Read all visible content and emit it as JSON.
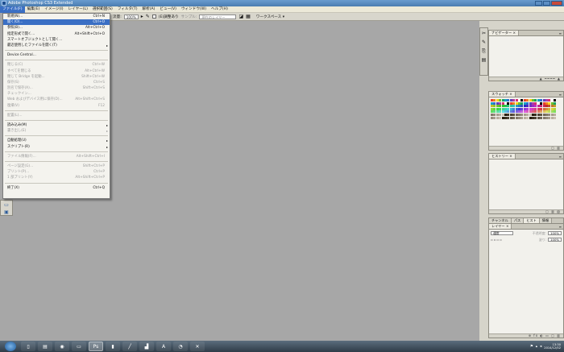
{
  "window": {
    "title": "Adobe Photoshop CS3 Extended"
  },
  "menubar": [
    {
      "label": "ファイル(F)",
      "active": true
    },
    {
      "label": "編集(E)"
    },
    {
      "label": "イメージ(I)"
    },
    {
      "label": "レイヤー(L)"
    },
    {
      "label": "選択範囲(S)"
    },
    {
      "label": "フィルタ(T)"
    },
    {
      "label": "解析(A)"
    },
    {
      "label": "ビュー(V)"
    },
    {
      "label": "ウィンドウ(W)"
    },
    {
      "label": "ヘルプ(H)"
    }
  ],
  "options": {
    "zoom_label": "流量:",
    "zoom_value": "100%",
    "airbrush_label": "(E)調整あり",
    "sample_label": "サンプル:",
    "sample_value": "現在のレイヤー",
    "workspace_label": "ワークスペース ▾"
  },
  "file_menu": [
    {
      "label": "新規(N)...",
      "shortcut": "Ctrl+N"
    },
    {
      "label": "開く(O)...",
      "shortcut": "Ctrl+O",
      "highlight": true
    },
    {
      "label": "参照(B)...",
      "shortcut": "Alt+Ctrl+O"
    },
    {
      "label": "指定形式で開く...",
      "shortcut": "Alt+Shift+Ctrl+O"
    },
    {
      "label": "スマートオブジェクトとして開く..."
    },
    {
      "label": "最近使用したファイルを開く(T)",
      "arrow": true
    },
    {
      "sep": true
    },
    {
      "label": "Device Central..."
    },
    {
      "sep": true
    },
    {
      "label": "閉じる(C)",
      "shortcut": "Ctrl+W",
      "disabled": true
    },
    {
      "label": "すべてを閉じる",
      "shortcut": "Alt+Ctrl+W",
      "disabled": true
    },
    {
      "label": "閉じて Bridge を起動...",
      "shortcut": "Shift+Ctrl+W",
      "disabled": true
    },
    {
      "label": "保存(S)",
      "shortcut": "Ctrl+S",
      "disabled": true
    },
    {
      "label": "別名で保存(A)...",
      "shortcut": "Shift+Ctrl+S",
      "disabled": true
    },
    {
      "label": "チェックイン...",
      "disabled": true
    },
    {
      "label": "Web およびデバイス用に保存(D)...",
      "shortcut": "Alt+Shift+Ctrl+S",
      "disabled": true
    },
    {
      "label": "復帰(V)",
      "shortcut": "F12",
      "disabled": true
    },
    {
      "sep": true
    },
    {
      "label": "配置(L)...",
      "disabled": true
    },
    {
      "sep": true
    },
    {
      "label": "読み込み(M)",
      "arrow": true
    },
    {
      "label": "書き出し(E)",
      "arrow": true,
      "disabled": true
    },
    {
      "sep": true
    },
    {
      "label": "自動処理(U)",
      "arrow": true
    },
    {
      "label": "スクリプト(R)",
      "arrow": true
    },
    {
      "sep": true
    },
    {
      "label": "ファイル情報(F)...",
      "shortcut": "Alt+Shift+Ctrl+I",
      "disabled": true
    },
    {
      "sep": true
    },
    {
      "label": "ページ設定(G)...",
      "shortcut": "Shift+Ctrl+P",
      "disabled": true
    },
    {
      "label": "プリント(P)...",
      "shortcut": "Ctrl+P",
      "disabled": true
    },
    {
      "label": "1 部プリント(Y)",
      "shortcut": "Alt+Shift+Ctrl+P",
      "disabled": true
    },
    {
      "sep": true
    },
    {
      "label": "終了(X)",
      "shortcut": "Ctrl+Q"
    }
  ],
  "panels": {
    "navigator_tab": "ナビゲーター ×",
    "swatches_tab": "スウォッチ ×",
    "history_tab": "ヒストリー ×",
    "channel_tabs": [
      "チャンネル",
      "パス",
      "ヒスト",
      "情報"
    ],
    "layers_tab": "レイヤー ×",
    "blend_mode": "通常",
    "opacity_label": "不透明度:",
    "opacity_value": "100%",
    "fill_label": "塗り:",
    "fill_value": "100%"
  },
  "taskbar": {
    "time": "13:30",
    "date": "2014/12/02"
  },
  "colors": {
    "accent": "#3a6fc4",
    "workspace": "#a7a7a7"
  }
}
